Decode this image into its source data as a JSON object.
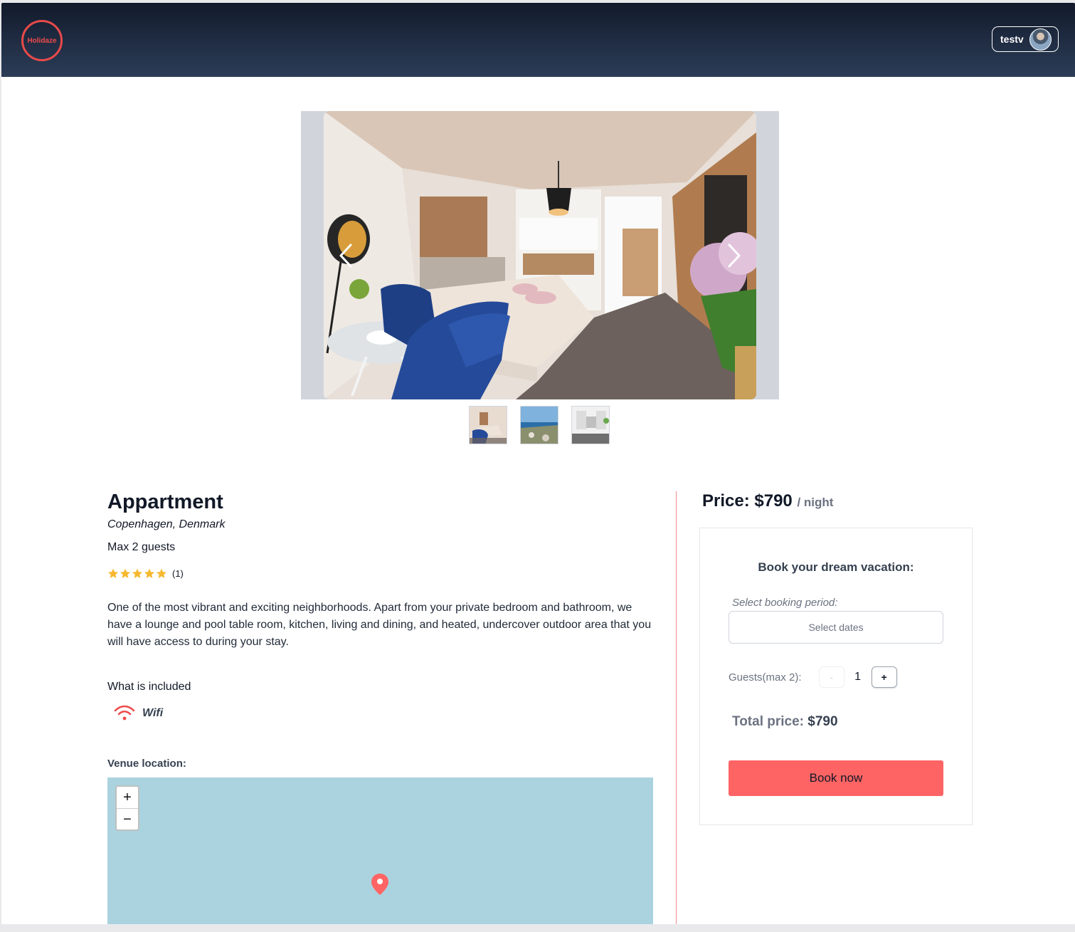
{
  "header": {
    "logo_text": "Holidaze",
    "username": "testv",
    "brand_color": "#ef4b4b"
  },
  "gallery": {
    "main_image_alt": "Appartment bedroom with blue armchairs",
    "thumbnails": [
      "room",
      "coastline",
      "kitchen"
    ],
    "prev_icon": "chevron-left-icon",
    "next_icon": "chevron-right-icon"
  },
  "venue": {
    "name": "Appartment",
    "location": "Copenhagen, Denmark",
    "max_guests_text": "Max 2 guests",
    "rating": 5,
    "rating_count": "(1)",
    "description": "One of the most vibrant and exciting neighborhoods. Apart from your private bedroom and bathroom, we have a lounge and pool table room, kitchen, living and dining, and heated, undercover outdoor area that you will have access to during your stay.",
    "included_heading": "What is included",
    "amenities": [
      {
        "icon": "wifi-icon",
        "label": "Wifi"
      }
    ],
    "location_heading": "Venue location:"
  },
  "map": {
    "zoom_in": "+",
    "zoom_out": "−"
  },
  "booking": {
    "price_label": "Price: $790",
    "price_unit": "/ night",
    "card_title": "Book your dream vacation:",
    "period_label": "Select booking period:",
    "dates_placeholder": "Select dates",
    "guests_label": "Guests(max 2):",
    "minus_label": "-",
    "guests_value": "1",
    "plus_label": "+",
    "total_label": "Total price:",
    "total_value": "$790",
    "book_button": "Book now",
    "accent_color": "#fe6464"
  }
}
